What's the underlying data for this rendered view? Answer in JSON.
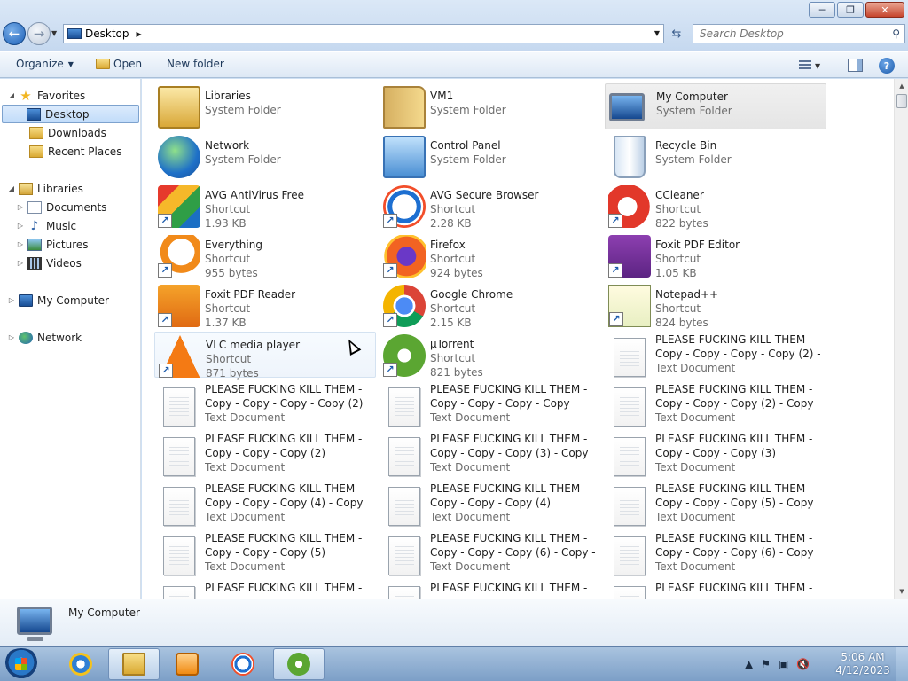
{
  "window": {
    "buttons": {
      "minimize": "─",
      "maximize": "❐",
      "close": "✕"
    }
  },
  "address": {
    "crumb": "Desktop",
    "search_placeholder": "Search Desktop"
  },
  "toolbar": {
    "organize": "Organize",
    "open": "Open",
    "new_folder": "New folder"
  },
  "sidebar": {
    "favorites": "Favorites",
    "desktop": "Desktop",
    "downloads": "Downloads",
    "recent": "Recent Places",
    "libraries": "Libraries",
    "documents": "Documents",
    "music": "Music",
    "pictures": "Pictures",
    "videos": "Videos",
    "computer": "My Computer",
    "network": "Network"
  },
  "items": [
    {
      "name": "Libraries",
      "type": "System Folder",
      "size": "",
      "icon": "libraries-icon"
    },
    {
      "name": "VM1",
      "type": "System Folder",
      "size": "",
      "icon": "user-folder-icon"
    },
    {
      "name": "My Computer",
      "type": "System Folder",
      "size": "",
      "icon": "computer-icon"
    },
    {
      "name": "Network",
      "type": "System Folder",
      "size": "",
      "icon": "network-icon"
    },
    {
      "name": "Control Panel",
      "type": "System Folder",
      "size": "",
      "icon": "control-panel-icon"
    },
    {
      "name": "Recycle Bin",
      "type": "System Folder",
      "size": "",
      "icon": "recycle-bin-icon"
    },
    {
      "name": "AVG AntiVirus Free",
      "type": "Shortcut",
      "size": "1.93 KB",
      "icon": "avg-antivirus-icon"
    },
    {
      "name": "AVG Secure Browser",
      "type": "Shortcut",
      "size": "2.28 KB",
      "icon": "avg-browser-icon"
    },
    {
      "name": "CCleaner",
      "type": "Shortcut",
      "size": "822 bytes",
      "icon": "ccleaner-icon"
    },
    {
      "name": "Everything",
      "type": "Shortcut",
      "size": "955 bytes",
      "icon": "everything-icon"
    },
    {
      "name": "Firefox",
      "type": "Shortcut",
      "size": "924 bytes",
      "icon": "firefox-icon"
    },
    {
      "name": "Foxit PDF Editor",
      "type": "Shortcut",
      "size": "1.05 KB",
      "icon": "foxit-editor-icon"
    },
    {
      "name": "Foxit PDF Reader",
      "type": "Shortcut",
      "size": "1.37 KB",
      "icon": "foxit-reader-icon"
    },
    {
      "name": "Google Chrome",
      "type": "Shortcut",
      "size": "2.15 KB",
      "icon": "chrome-icon"
    },
    {
      "name": "Notepad++",
      "type": "Shortcut",
      "size": "824 bytes",
      "icon": "notepad-plus-plus-icon"
    },
    {
      "name": "VLC media player",
      "type": "Shortcut",
      "size": "871 bytes",
      "icon": "vlc-icon"
    },
    {
      "name": "µTorrent",
      "type": "Shortcut",
      "size": "821 bytes",
      "icon": "utorrent-icon"
    }
  ],
  "docs": [
    {
      "l1": "PLEASE FUCKING KILL THEM -",
      "l2": "Copy - Copy - Copy - Copy (2) - ...",
      "type": "Text Document"
    },
    {
      "l1": "PLEASE FUCKING KILL THEM -",
      "l2": "Copy - Copy - Copy - Copy (2)",
      "type": "Text Document"
    },
    {
      "l1": "PLEASE FUCKING KILL THEM -",
      "l2": "Copy - Copy - Copy - Copy",
      "type": "Text Document"
    },
    {
      "l1": "PLEASE FUCKING KILL THEM -",
      "l2": "Copy - Copy - Copy (2) - Copy",
      "type": "Text Document"
    },
    {
      "l1": "PLEASE FUCKING KILL THEM -",
      "l2": "Copy - Copy - Copy (2)",
      "type": "Text Document"
    },
    {
      "l1": "PLEASE FUCKING KILL THEM -",
      "l2": "Copy - Copy - Copy (3) - Copy",
      "type": "Text Document"
    },
    {
      "l1": "PLEASE FUCKING KILL THEM -",
      "l2": "Copy - Copy - Copy (3)",
      "type": "Text Document"
    },
    {
      "l1": "PLEASE FUCKING KILL THEM -",
      "l2": "Copy - Copy - Copy (4) - Copy",
      "type": "Text Document"
    },
    {
      "l1": "PLEASE FUCKING KILL THEM -",
      "l2": "Copy - Copy - Copy (4)",
      "type": "Text Document"
    },
    {
      "l1": "PLEASE FUCKING KILL THEM -",
      "l2": "Copy - Copy - Copy (5) - Copy",
      "type": "Text Document"
    },
    {
      "l1": "PLEASE FUCKING KILL THEM -",
      "l2": "Copy - Copy - Copy (5)",
      "type": "Text Document"
    },
    {
      "l1": "PLEASE FUCKING KILL THEM -",
      "l2": "Copy - Copy - Copy (6) - Copy - ...",
      "type": "Text Document"
    },
    {
      "l1": "PLEASE FUCKING KILL THEM -",
      "l2": "Copy - Copy - Copy (6) - Copy",
      "type": "Text Document"
    }
  ],
  "partial_docs": [
    "PLEASE FUCKING KILL THEM -",
    "PLEASE FUCKING KILL THEM -",
    "PLEASE FUCKING KILL THEM -"
  ],
  "shortcut_arrow": "↗",
  "details": {
    "name": "My Computer"
  },
  "tray": {
    "time": "5:06 AM",
    "date": "4/12/2023"
  }
}
